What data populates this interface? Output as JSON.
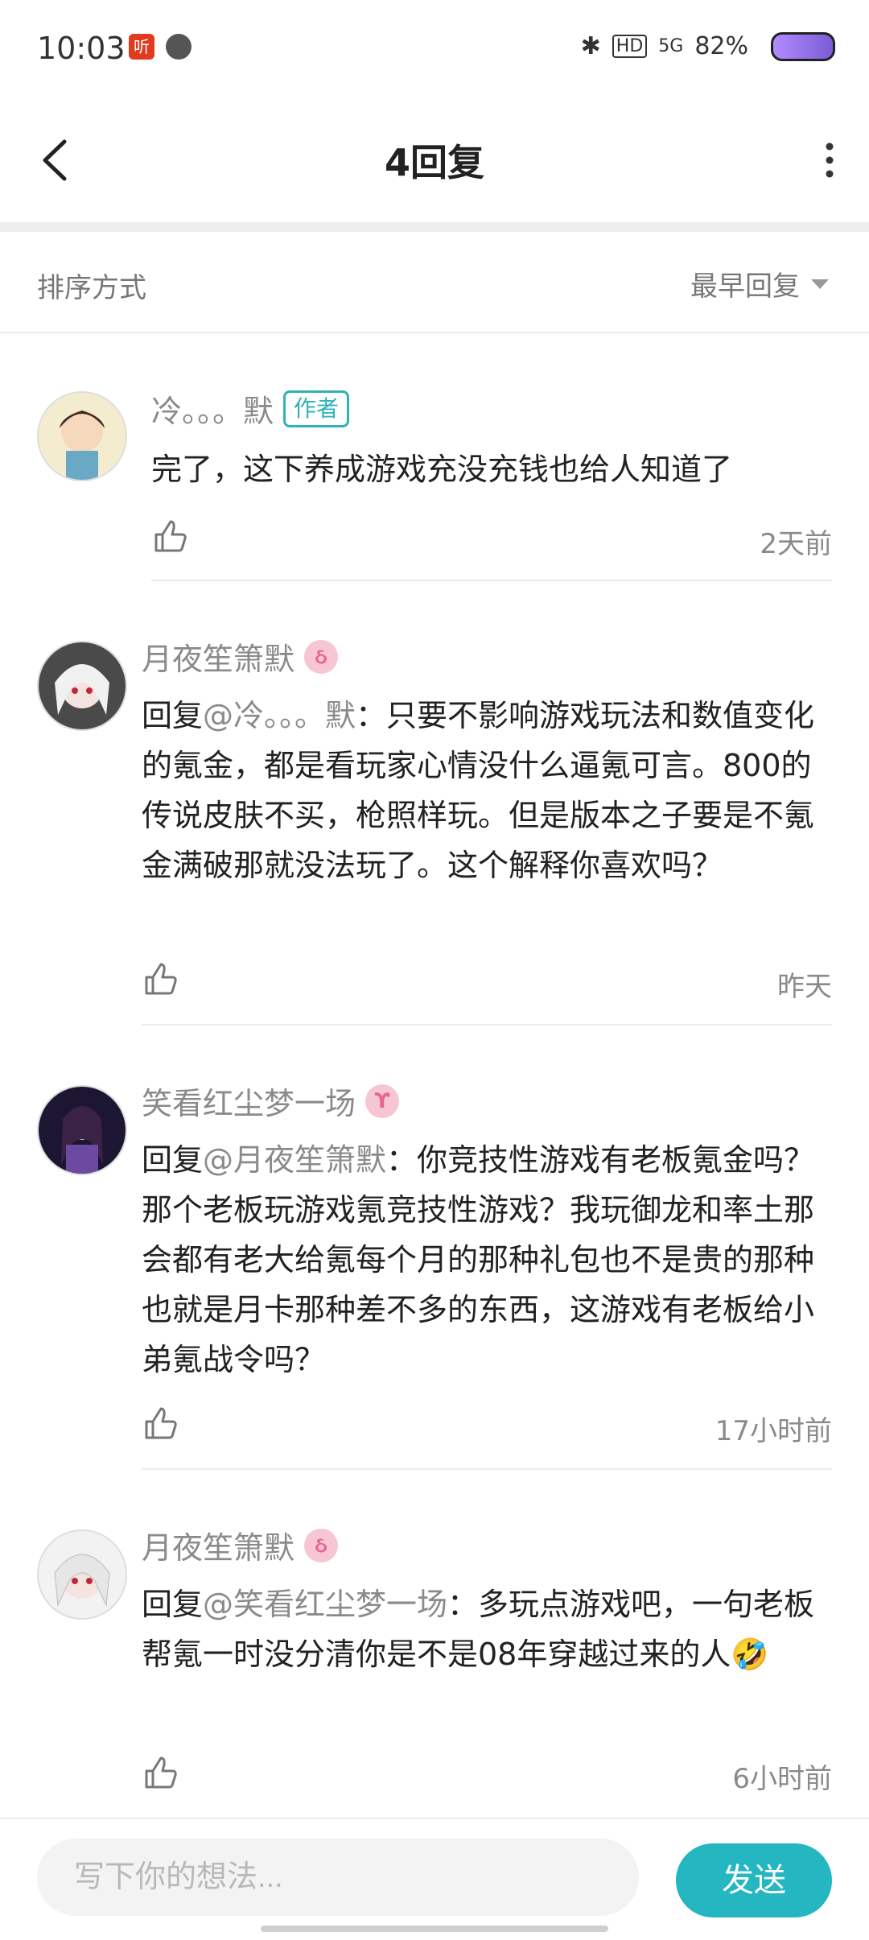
{
  "status_bar": {
    "time": "10:03",
    "battery_percent": "82%",
    "network": "5G",
    "hd": "HD",
    "app_icon_label": "听"
  },
  "header": {
    "title": "4回复"
  },
  "sort": {
    "label": "排序方式",
    "selected": "最早回复"
  },
  "comments": [
    {
      "username": "冷。。。默",
      "badge": "作者",
      "text": "完了，这下养成游戏充没充钱也给人知道了",
      "time": "2天前"
    },
    {
      "username": "月夜笙箫默",
      "reply_prefix": "回复",
      "mention": "@冷。。。默",
      "text": "：只要不影响游戏玩法和数值变化的氪金，都是看玩家心情没什么逼氪可言。800的传说皮肤不买，枪照样玩。但是版本之子要是不氪金满破那就没法玩了。这个解释你喜欢吗？",
      "time": "昨天"
    },
    {
      "username": "笑看红尘梦一场",
      "reply_prefix": "回复",
      "mention": "@月夜笙箫默",
      "text": "：你竞技性游戏有老板氪金吗？那个老板玩游戏氪竞技性游戏？我玩御龙和率土那会都有老大给氪每个月的那种礼包也不是贵的那种也就是月卡那种差不多的东西，这游戏有老板给小弟氪战令吗？",
      "time": "17小时前"
    },
    {
      "username": "月夜笙箫默",
      "reply_prefix": "回复",
      "mention": "@笑看红尘梦一场",
      "text": "：多玩点游戏吧，一句老板帮氪一时没分清你是不是08年穿越过来的人🤣",
      "time": "6小时前"
    }
  ],
  "composer": {
    "placeholder": "写下你的想法...",
    "send_label": "发送"
  },
  "colors": {
    "accent": "#24b6c1",
    "author_badge": "#2fb3b8",
    "muted_text": "#8a8a8a"
  },
  "icons": [
    "back-arrow-icon",
    "more-vertical-icon",
    "caret-down-icon",
    "thumbs-up-icon",
    "level-badge-icon"
  ]
}
